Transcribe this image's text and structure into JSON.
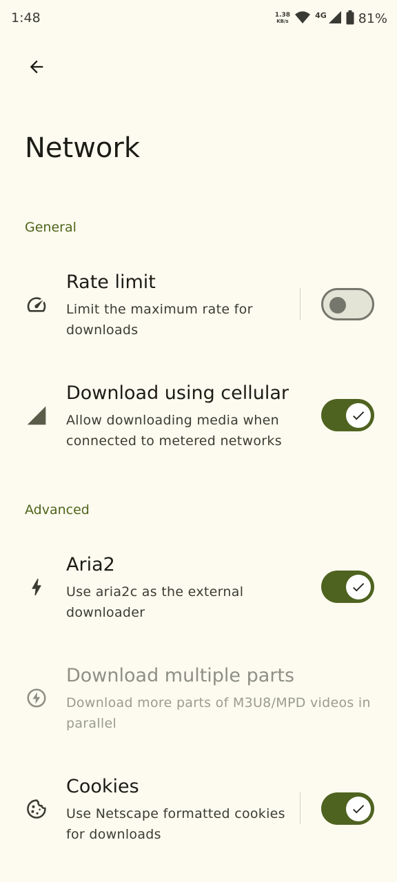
{
  "status_bar": {
    "time": "1:48",
    "net_speed_value": "1.38",
    "net_speed_unit": "KB/s",
    "network_type": "4G",
    "battery": "81%"
  },
  "header": {
    "title": "Network"
  },
  "sections": {
    "general": "General",
    "advanced": "Advanced"
  },
  "prefs": {
    "rate_limit": {
      "title": "Rate limit",
      "summary": "Limit the maximum rate for downloads",
      "enabled": false
    },
    "cellular": {
      "title": "Download using cellular",
      "summary": "Allow downloading media when connected to metered networks",
      "enabled": true
    },
    "aria2": {
      "title": "Aria2",
      "summary": "Use aria2c as the external downloader",
      "enabled": true
    },
    "multiple_parts": {
      "title": "Download multiple parts",
      "summary": "Download more parts of M3U8/MPD videos in parallel"
    },
    "cookies": {
      "title": "Cookies",
      "summary": "Use Netscape formatted cookies for downloads",
      "enabled": true
    }
  },
  "icons": {
    "back": "arrow-back-icon",
    "rate_limit": "speed-icon",
    "cellular": "signal-cellular-icon",
    "aria2": "bolt-icon",
    "multiple_parts": "offline-bolt-icon",
    "cookies": "cookie-icon"
  },
  "colors": {
    "background": "#fdfbf0",
    "accent": "#4f6320",
    "section_header": "#4e6419"
  }
}
